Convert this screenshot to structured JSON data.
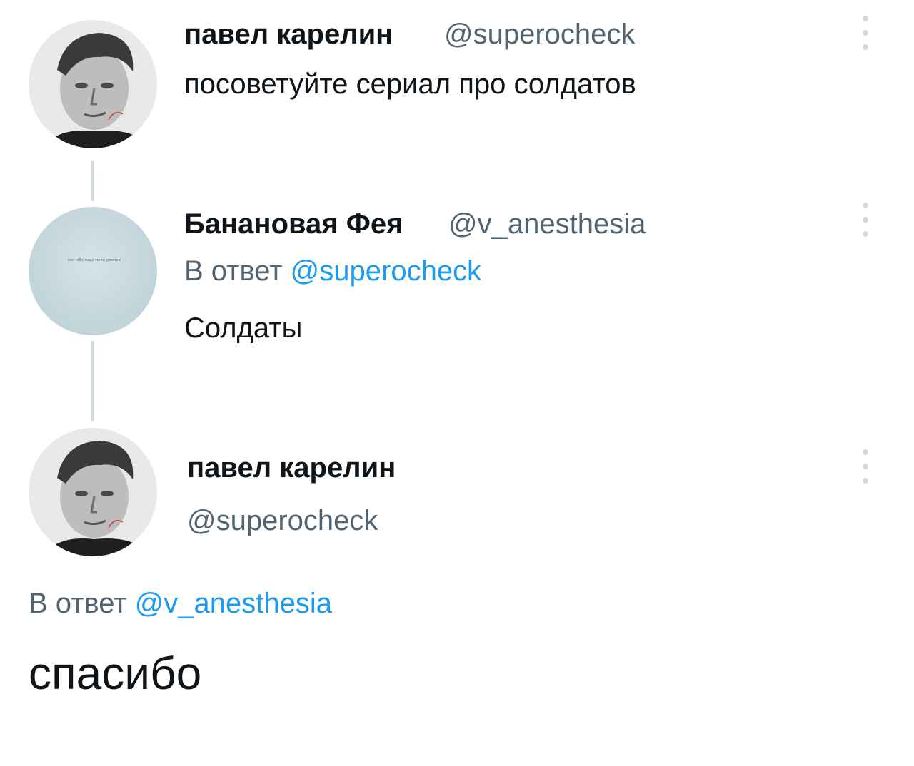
{
  "tweets": [
    {
      "author_name": "павел карелин",
      "author_handle": "@superocheck",
      "text": "посоветуйте сериал про солдатов",
      "avatar": "man-portrait-avatar",
      "more_icon": "more-vertical-icon"
    },
    {
      "author_name": "Банановая Фея",
      "author_handle": "@v_anesthesia",
      "reply_prefix": "В ответ",
      "reply_to": "@superocheck",
      "text": "Солдаты",
      "avatar": "sky-avatar",
      "avatar_caption": "мне тебя, когда что ты успела в",
      "more_icon": "more-vertical-icon"
    },
    {
      "author_name": "павел карелин",
      "author_handle": "@superocheck",
      "reply_prefix": "В ответ",
      "reply_to": "@v_anesthesia",
      "text": "спасибо",
      "avatar": "man-portrait-avatar",
      "more_icon": "more-vertical-icon"
    }
  ],
  "colors": {
    "text": "#0f1419",
    "secondary": "#536471",
    "link": "#1d9bf0",
    "thread_line": "#cfd9de"
  }
}
